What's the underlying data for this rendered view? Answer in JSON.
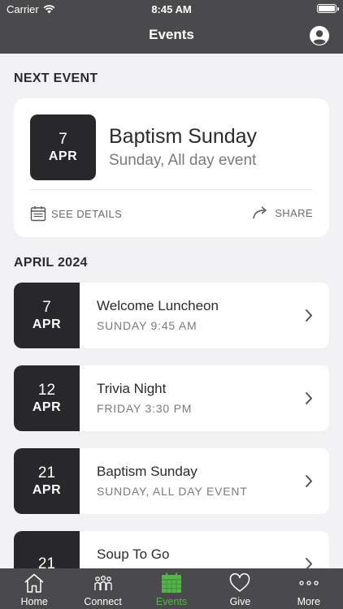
{
  "status_bar": {
    "carrier": "Carrier",
    "time": "8:45 AM"
  },
  "nav": {
    "title": "Events"
  },
  "next_event": {
    "section_title": "NEXT EVENT",
    "day": "7",
    "month": "APR",
    "title": "Baptism Sunday",
    "subtitle": "Sunday, All day event",
    "details_label": "SEE DETAILS",
    "share_label": "SHARE"
  },
  "month_section": {
    "title": "APRIL 2024"
  },
  "events": [
    {
      "day": "7",
      "month": "APR",
      "title": "Welcome Luncheon",
      "subtitle": "SUNDAY 9:45 AM"
    },
    {
      "day": "12",
      "month": "APR",
      "title": "Trivia Night",
      "subtitle": "FRIDAY 3:30 PM"
    },
    {
      "day": "21",
      "month": "APR",
      "title": "Baptism Sunday",
      "subtitle": "SUNDAY, ALL DAY EVENT"
    },
    {
      "day": "21",
      "month": "",
      "title": "Soup To Go",
      "subtitle": ""
    }
  ],
  "tabs": [
    {
      "label": "Home",
      "icon": "home-icon"
    },
    {
      "label": "Connect",
      "icon": "people-icon"
    },
    {
      "label": "Events",
      "icon": "calendar-icon",
      "active": true
    },
    {
      "label": "Give",
      "icon": "heart-icon"
    },
    {
      "label": "More",
      "icon": "more-icon"
    }
  ],
  "colors": {
    "bar": "#4a4a4c",
    "background": "#f2f2f5",
    "date_block": "#28282b",
    "active_tab": "#55b54b"
  }
}
